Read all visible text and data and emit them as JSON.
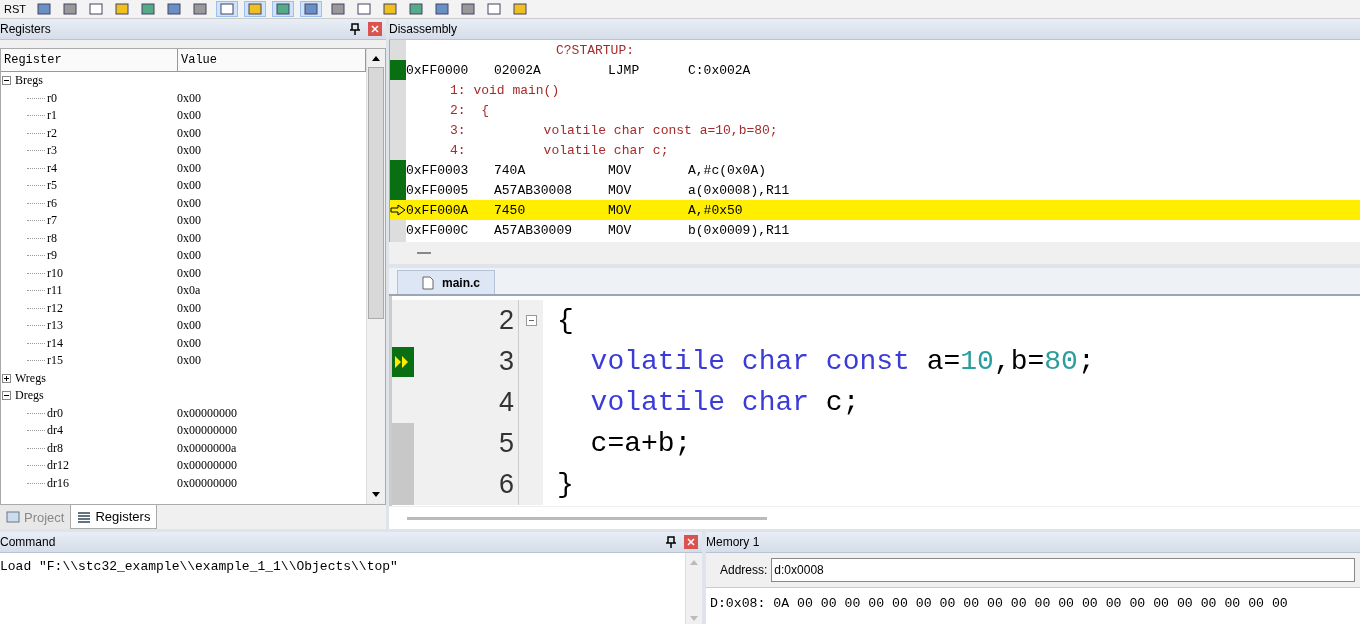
{
  "toolbar": {
    "reset_label": "RST"
  },
  "registers": {
    "title": "Registers",
    "columns": [
      "Register",
      "Value"
    ],
    "tree": [
      {
        "name": "Bregs",
        "expanded": true,
        "children": [
          {
            "name": "r0",
            "value": "0x00"
          },
          {
            "name": "r1",
            "value": "0x00"
          },
          {
            "name": "r2",
            "value": "0x00"
          },
          {
            "name": "r3",
            "value": "0x00"
          },
          {
            "name": "r4",
            "value": "0x00"
          },
          {
            "name": "r5",
            "value": "0x00"
          },
          {
            "name": "r6",
            "value": "0x00"
          },
          {
            "name": "r7",
            "value": "0x00"
          },
          {
            "name": "r8",
            "value": "0x00"
          },
          {
            "name": "r9",
            "value": "0x00"
          },
          {
            "name": "r10",
            "value": "0x00"
          },
          {
            "name": "r11",
            "value": "0x0a"
          },
          {
            "name": "r12",
            "value": "0x00"
          },
          {
            "name": "r13",
            "value": "0x00"
          },
          {
            "name": "r14",
            "value": "0x00"
          },
          {
            "name": "r15",
            "value": "0x00"
          }
        ]
      },
      {
        "name": "Wregs",
        "expanded": false
      },
      {
        "name": "Dregs",
        "expanded": true,
        "children": [
          {
            "name": "dr0",
            "value": "0x00000000"
          },
          {
            "name": "dr4",
            "value": "0x00000000"
          },
          {
            "name": "dr8",
            "value": "0x0000000a"
          },
          {
            "name": "dr12",
            "value": "0x00000000"
          },
          {
            "name": "dr16",
            "value": "0x00000000"
          }
        ]
      }
    ],
    "tabs": [
      {
        "label": "Project",
        "selected": false
      },
      {
        "label": "Registers",
        "selected": true
      }
    ]
  },
  "disassembly": {
    "title": "Disassembly",
    "lines": [
      {
        "kind": "label",
        "text": "C?STARTUP:"
      },
      {
        "kind": "asm",
        "address": "0xFF0000",
        "code": "02002A",
        "mnemonic": "LJMP",
        "operand": "C:0x002A",
        "executed": true,
        "current": false
      },
      {
        "kind": "source",
        "text": "1: void main()"
      },
      {
        "kind": "source",
        "text": "2:  {"
      },
      {
        "kind": "source",
        "text": "3:          volatile char const a=10,b=80;"
      },
      {
        "kind": "source",
        "text": "4:          volatile char c;"
      },
      {
        "kind": "asm",
        "address": "0xFF0003",
        "code": "740A",
        "mnemonic": "MOV",
        "operand": "A,#c(0x0A)",
        "executed": true,
        "current": false
      },
      {
        "kind": "asm",
        "address": "0xFF0005",
        "code": "A57AB30008",
        "mnemonic": "MOV",
        "operand": "a(0x0008),R11",
        "executed": true,
        "current": false
      },
      {
        "kind": "asm",
        "address": "0xFF000A",
        "code": "7450",
        "mnemonic": "MOV",
        "operand": "A,#0x50",
        "executed": false,
        "current": true
      },
      {
        "kind": "asm",
        "address": "0xFF000C",
        "code": "A57AB30009",
        "mnemonic": "MOV",
        "operand": "b(0x0009),R11",
        "executed": false,
        "current": false
      }
    ]
  },
  "editor": {
    "tab": "main.c",
    "lines": [
      {
        "number": "2",
        "foldable": true,
        "current": false,
        "executed": false,
        "tokens": [
          {
            "kind": "plain",
            "text": "{"
          }
        ]
      },
      {
        "number": "3",
        "foldable": false,
        "current": true,
        "executed": false,
        "tokens": [
          {
            "kind": "keyword",
            "text": "  volatile char const"
          },
          {
            "kind": "plain",
            "text": " a="
          },
          {
            "kind": "number",
            "text": "10"
          },
          {
            "kind": "plain",
            "text": ",b="
          },
          {
            "kind": "number",
            "text": "80"
          },
          {
            "kind": "plain",
            "text": ";"
          }
        ]
      },
      {
        "number": "4",
        "foldable": false,
        "current": false,
        "executed": false,
        "tokens": [
          {
            "kind": "keyword",
            "text": "  volatile char"
          },
          {
            "kind": "plain",
            "text": " c;"
          }
        ]
      },
      {
        "number": "5",
        "foldable": false,
        "current": false,
        "executed": true,
        "tokens": [
          {
            "kind": "plain",
            "text": "  c=a+b;"
          }
        ]
      },
      {
        "number": "6",
        "foldable": false,
        "current": false,
        "executed": true,
        "tokens": [
          {
            "kind": "plain",
            "text": "}"
          }
        ]
      }
    ]
  },
  "command": {
    "title": "Command",
    "output": "Load \"F:\\\\stc32_example\\\\example_1_1\\\\Objects\\\\top\""
  },
  "memory": {
    "title": "Memory 1",
    "address_label": "Address:",
    "address": "d:0x0008",
    "row": "D:0x08: 0A 00 00 00 00 00 00 00 00 00 00 00 00 00 00 00 00 00 00 00 00 00"
  }
}
